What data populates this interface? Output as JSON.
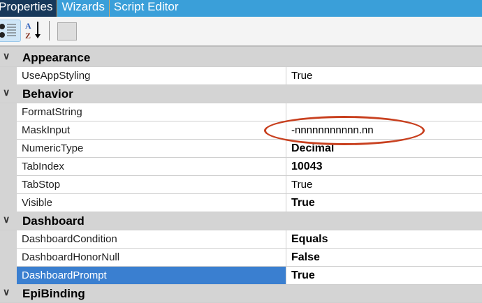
{
  "tabs": [
    {
      "label": "Properties",
      "active": true
    },
    {
      "label": "Wizards"
    },
    {
      "label": "Script Editor"
    }
  ],
  "toolbar": {
    "categorized": "categorized-icon",
    "alphabetical": "sort-az-icon",
    "property_pages": "property-pages-icon"
  },
  "groups": [
    {
      "name": "Appearance",
      "props": [
        {
          "name": "UseAppStyling",
          "value": "True",
          "bold": false
        }
      ]
    },
    {
      "name": "Behavior",
      "props": [
        {
          "name": "FormatString",
          "value": "",
          "bold": false
        },
        {
          "name": "MaskInput",
          "value": "-nnnnnnnnnnn.nn",
          "bold": false
        },
        {
          "name": "NumericType",
          "value": "Decimal",
          "bold": true
        },
        {
          "name": "TabIndex",
          "value": "10043",
          "bold": true
        },
        {
          "name": "TabStop",
          "value": "True",
          "bold": false
        },
        {
          "name": "Visible",
          "value": "True",
          "bold": true
        }
      ]
    },
    {
      "name": "Dashboard",
      "props": [
        {
          "name": "DashboardCondition",
          "value": "Equals",
          "bold": true
        },
        {
          "name": "DashboardHonorNull",
          "value": "False",
          "bold": true
        },
        {
          "name": "DashboardPrompt",
          "value": "True",
          "bold": true,
          "selected": true
        }
      ]
    },
    {
      "name": "EpiBinding",
      "props": []
    }
  ],
  "colors": {
    "annotation": "#c8401f",
    "selection": "#3a7fd0",
    "tab_bar": "#3a9fd9"
  }
}
